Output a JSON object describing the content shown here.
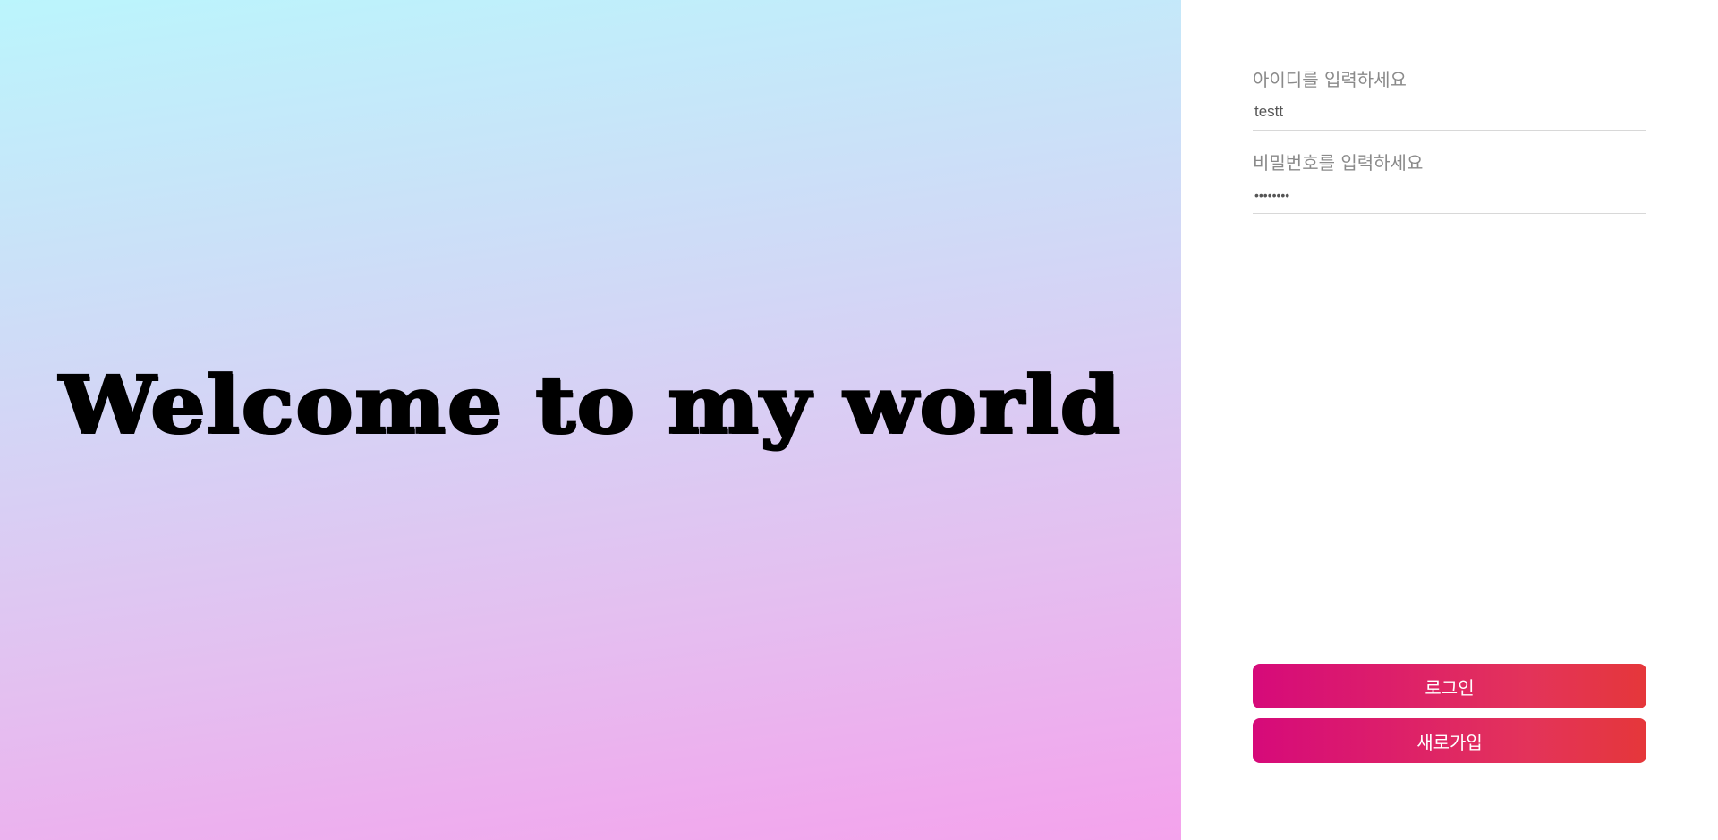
{
  "hero": {
    "title": "Welcome to my world"
  },
  "login_form": {
    "username": {
      "label": "아이디를 입력하세요",
      "value": "testt"
    },
    "password": {
      "label": "비밀번호를 입력하세요",
      "value": "testtest"
    },
    "login_button_label": "로그인",
    "signup_button_label": "새로가입"
  },
  "colors": {
    "hero_gradient_top": "#bbf5fc",
    "hero_gradient_bottom": "#f4a2ec",
    "button_gradient_start": "#d60a7a",
    "button_gradient_end": "#e5373a"
  }
}
